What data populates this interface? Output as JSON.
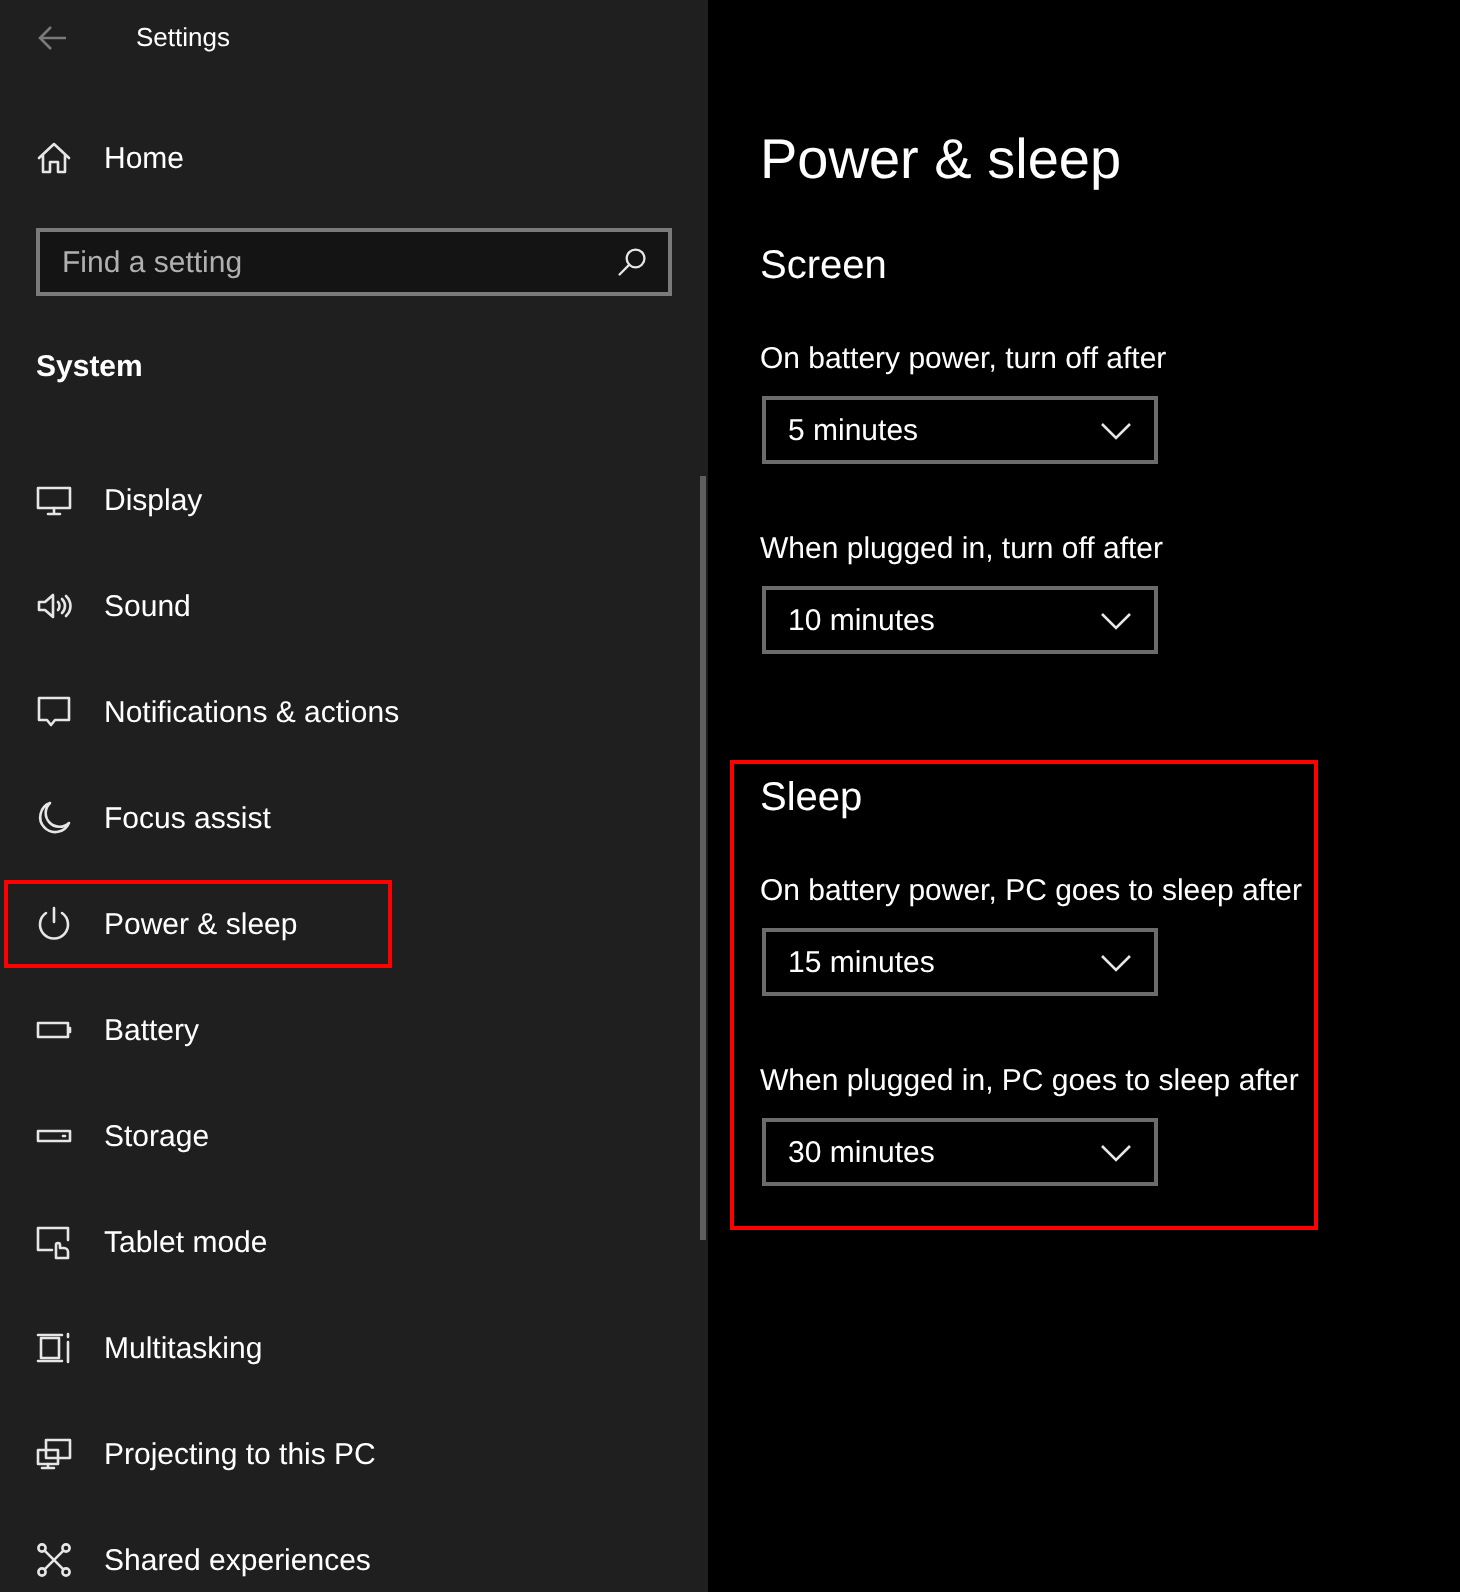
{
  "window": {
    "title": "Settings"
  },
  "sidebar": {
    "home": {
      "label": "Home"
    },
    "search": {
      "placeholder": "Find a setting"
    },
    "group": "System",
    "items": [
      {
        "label": "Display",
        "highlighted": false
      },
      {
        "label": "Sound",
        "highlighted": false
      },
      {
        "label": "Notifications & actions",
        "highlighted": false
      },
      {
        "label": "Focus assist",
        "highlighted": false
      },
      {
        "label": "Power & sleep",
        "highlighted": true
      },
      {
        "label": "Battery",
        "highlighted": false
      },
      {
        "label": "Storage",
        "highlighted": false
      },
      {
        "label": "Tablet mode",
        "highlighted": false
      },
      {
        "label": "Multitasking",
        "highlighted": false
      },
      {
        "label": "Projecting to this PC",
        "highlighted": false
      },
      {
        "label": "Shared experiences",
        "highlighted": false
      }
    ]
  },
  "main": {
    "title": "Power & sleep",
    "sections": [
      {
        "heading": "Screen",
        "highlighted": false,
        "settings": [
          {
            "label": "On battery power, turn off after",
            "value": "5 minutes"
          },
          {
            "label": "When plugged in, turn off after",
            "value": "10 minutes"
          }
        ]
      },
      {
        "heading": "Sleep",
        "highlighted": true,
        "settings": [
          {
            "label": "On battery power, PC goes to sleep after",
            "value": "15 minutes"
          },
          {
            "label": "When plugged in, PC goes to sleep after",
            "value": "30 minutes"
          }
        ]
      }
    ]
  }
}
